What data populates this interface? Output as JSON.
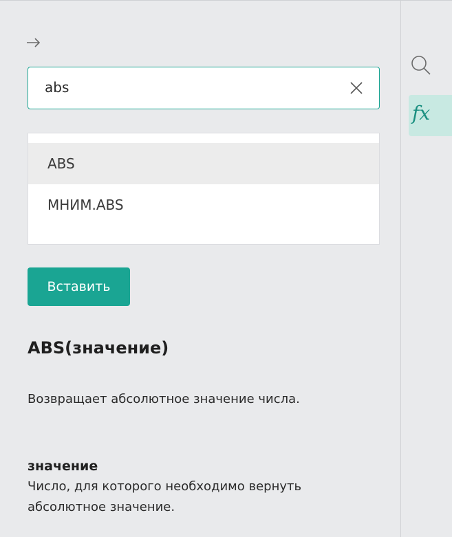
{
  "panel": {
    "collapse_icon": "arrow-right-icon",
    "search": {
      "value": "abs",
      "clear_icon": "close-icon",
      "accent_color": "#1aa593"
    },
    "results": [
      {
        "label": "ABS",
        "selected": true
      },
      {
        "label": "МНИМ.ABS",
        "selected": false
      }
    ],
    "insert_label": "Вставить",
    "function_signature": "ABS(значение)",
    "description": "Возвращает абсолютное значение числа.",
    "argument": {
      "name": "значение",
      "description": "Число, для которого необходимо вернуть абсолютное значение."
    }
  },
  "rail": {
    "search_icon": "search-icon",
    "functions_icon": "fx-icon",
    "functions_glyph": "fx",
    "active_color": "#c8e9e2"
  }
}
